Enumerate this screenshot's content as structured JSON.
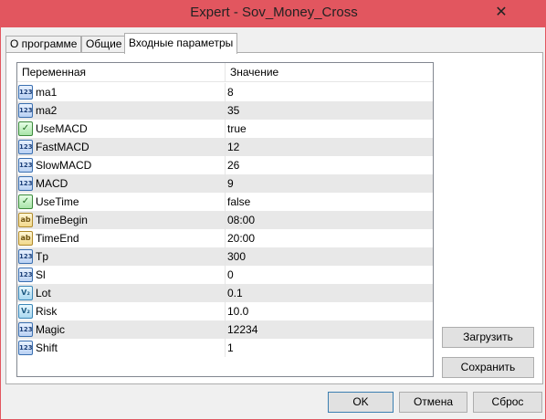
{
  "window": {
    "title": "Expert - Sov_Money_Cross",
    "close_glyph": "✕"
  },
  "tabs": [
    {
      "label": "О программе"
    },
    {
      "label": "Общие"
    },
    {
      "label": "Входные параметры"
    }
  ],
  "grid": {
    "headers": {
      "variable": "Переменная",
      "value": "Значение"
    },
    "rows": [
      {
        "name": "ma1",
        "value": "8",
        "icon": "int-icon"
      },
      {
        "name": "ma2",
        "value": "35",
        "icon": "int-icon"
      },
      {
        "name": "UseMACD",
        "value": "true",
        "icon": "bool-icon"
      },
      {
        "name": "FastMACD",
        "value": "12",
        "icon": "int-icon"
      },
      {
        "name": "SlowMACD",
        "value": "26",
        "icon": "int-icon"
      },
      {
        "name": "MACD",
        "value": "9",
        "icon": "int-icon"
      },
      {
        "name": "UseTime",
        "value": "false",
        "icon": "bool-icon"
      },
      {
        "name": "TimeBegin",
        "value": "08:00",
        "icon": "string-icon"
      },
      {
        "name": "TimeEnd",
        "value": "20:00",
        "icon": "string-icon"
      },
      {
        "name": "Tp",
        "value": "300",
        "icon": "int-icon"
      },
      {
        "name": "Sl",
        "value": "0",
        "icon": "int-icon"
      },
      {
        "name": "Lot",
        "value": "0.1",
        "icon": "double-icon"
      },
      {
        "name": "Risk",
        "value": "10.0",
        "icon": "double-icon"
      },
      {
        "name": "Magic",
        "value": "12234",
        "icon": "int-icon"
      },
      {
        "name": "Shift",
        "value": "1",
        "icon": "int-icon"
      }
    ]
  },
  "icons": {
    "int": "123",
    "bool": "✓",
    "string": "ab",
    "double": "V₂"
  },
  "buttons": {
    "load": "Загрузить",
    "save": "Сохранить",
    "ok": "OK",
    "cancel": "Отмена",
    "reset": "Сброс"
  }
}
